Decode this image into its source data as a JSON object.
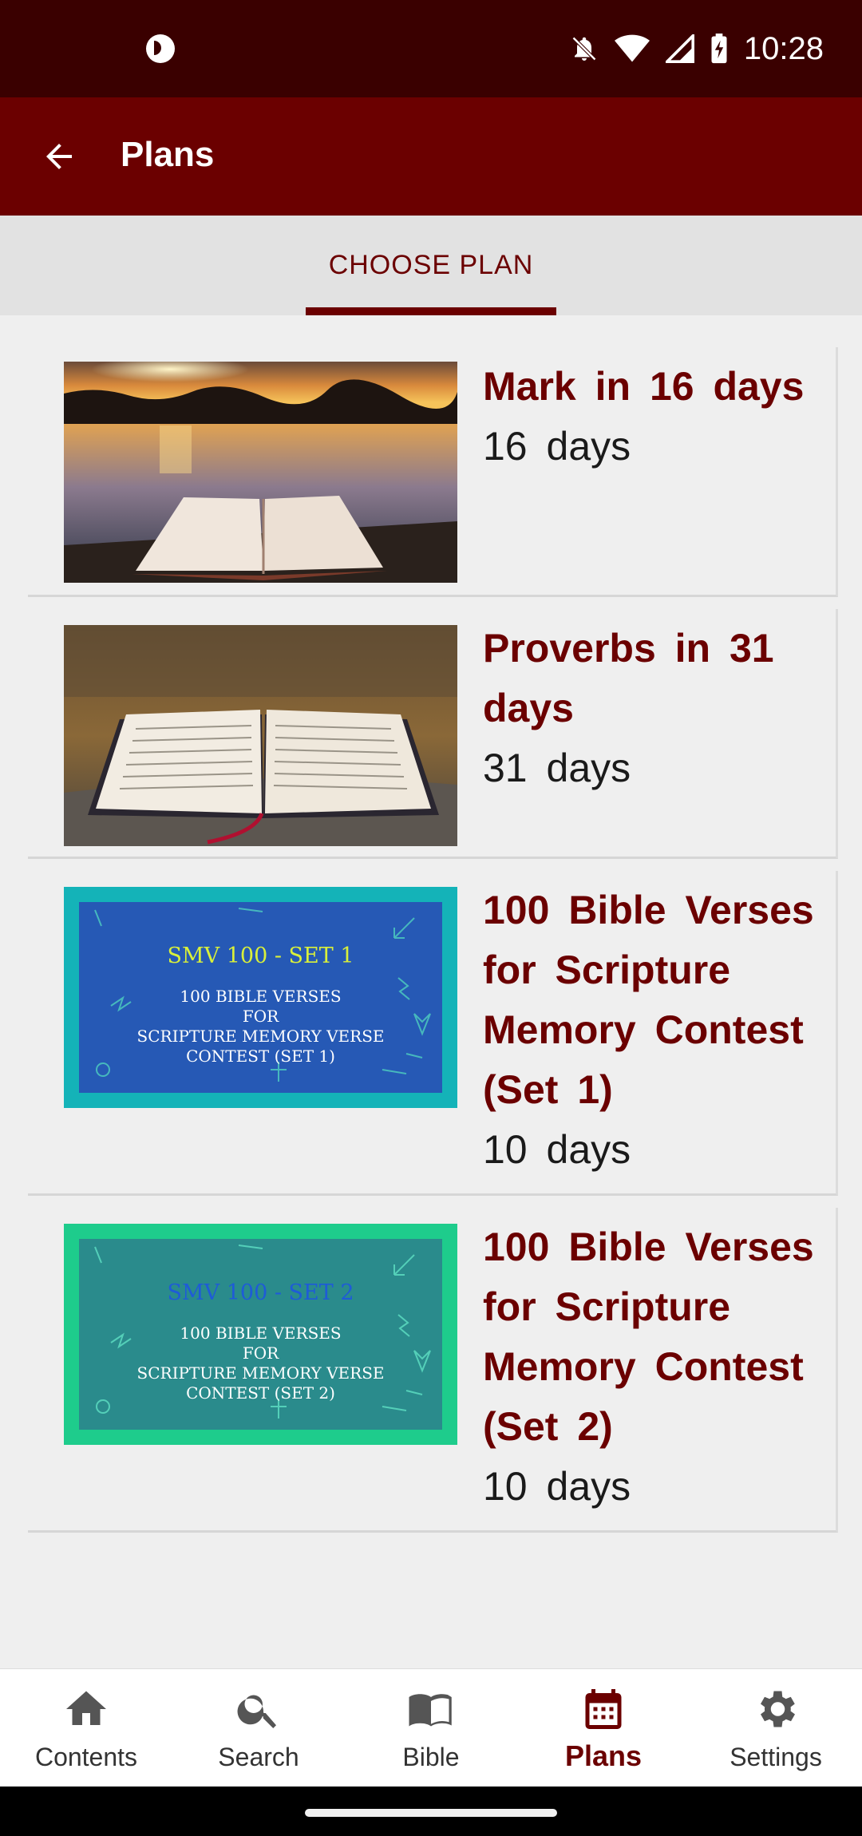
{
  "status_bar": {
    "time": "10:28"
  },
  "app_bar": {
    "title": "Plans"
  },
  "tabs": [
    {
      "label": "CHOOSE PLAN",
      "active": true
    }
  ],
  "plans": [
    {
      "title": "Mark in 16 days",
      "duration": "16 days",
      "image": "sunset-lake-open-bible"
    },
    {
      "title": "Proverbs in 31 days",
      "duration": "31 days",
      "image": "open-bible-autumn-field"
    },
    {
      "title": "100 Bible Verses for Scripture Memory Contest (Set 1)",
      "duration": "10 days",
      "image": "smv-set1-card",
      "banner": {
        "heading": "SMV 100 - SET 1",
        "line1": "100 BIBLE VERSES",
        "line2": "FOR",
        "line3": "SCRIPTURE MEMORY VERSE",
        "line4": "CONTEST (SET 1)"
      }
    },
    {
      "title": "100 Bible Verses for Scripture Memory Contest (Set 2)",
      "duration": "10 days",
      "image": "smv-set2-card",
      "banner": {
        "heading": "SMV 100 - SET 2",
        "line1": "100 BIBLE VERSES",
        "line2": "FOR",
        "line3": "SCRIPTURE MEMORY VERSE",
        "line4": "CONTEST (SET 2)"
      }
    }
  ],
  "bottom_nav": [
    {
      "label": "Contents",
      "icon": "home-icon"
    },
    {
      "label": "Search",
      "icon": "search-icon"
    },
    {
      "label": "Bible",
      "icon": "book-icon"
    },
    {
      "label": "Plans",
      "icon": "calendar-icon",
      "active": true
    },
    {
      "label": "Settings",
      "icon": "gear-icon"
    }
  ],
  "colors": {
    "primary": "#6b0000",
    "status_bar": "#3a0000",
    "background": "#efefef"
  }
}
